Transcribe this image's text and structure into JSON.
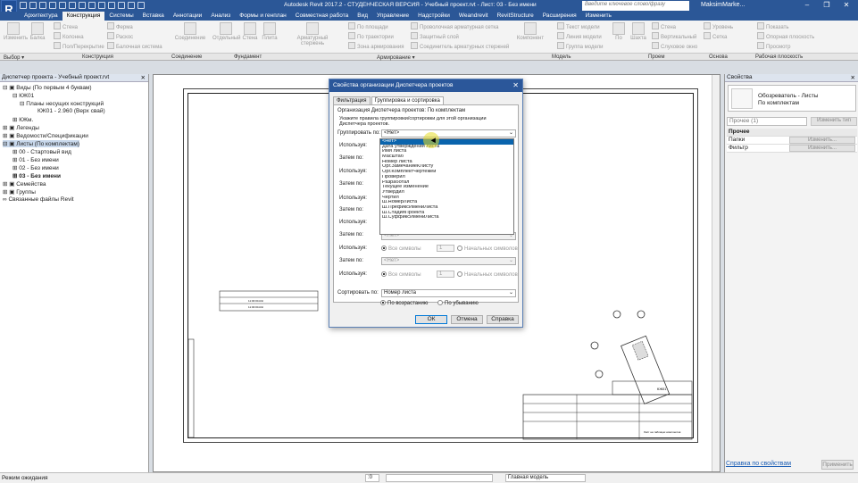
{
  "titlebar": {
    "logo": "R",
    "title": "Autodesk Revit 2017.2 - СТУДЕНЧЕСКАЯ ВЕРСИЯ -    Учебный проект.rvt - Лист: 03 - Без имени",
    "search_placeholder": "Введите ключевое слово/фразу",
    "user": "MaksimMarke...",
    "brand_color": "#2b5797"
  },
  "tabs": [
    "Архитектура",
    "Конструкция",
    "Системы",
    "Вставка",
    "Аннотации",
    "Анализ",
    "Формы и генплан",
    "Совместная работа",
    "Вид",
    "Управление",
    "Надстройки",
    "Weandrevit",
    "RevitStructure",
    "Расширения",
    "Изменить"
  ],
  "ribbon": {
    "tools": [
      "Изменить",
      "Балка",
      "Колонна",
      "Соединение",
      "Отдельный",
      "Стена",
      "Плита",
      "Арматурный стержень",
      "Компонент",
      "По",
      "Шахта",
      "Уровень"
    ],
    "small_tools": [
      "Стена",
      "Ферма",
      "Колонна",
      "Раскос",
      "Пол/Перекрытие",
      "Балочная система",
      "По площади",
      "По траектории",
      "Зона армирования",
      "Проволочная арматурная сетка",
      "Защитный слой",
      "Соединитель арматурных стержней",
      "Текст модели",
      "Линия модели",
      "Группа модели",
      "Стена",
      "Вертикальный",
      "Слуховое окно",
      "Сетка",
      "Показать",
      "Опорная плоскость",
      "Просмотр"
    ],
    "panels": [
      "Выбор ▾",
      "Конструкция",
      "Соединение",
      "Фундамент",
      "Армирование ▾",
      "Модель",
      "Проем",
      "Основа",
      "Рабочая плоскость"
    ]
  },
  "browser": {
    "title": "Диспетчер проекта - Учебный проект.rvt",
    "close": "✕",
    "nodes": [
      "Виды (По первым 4 буквам)",
      "КЖ01",
      "Планы несущих конструкций",
      "КЖ01 - 2.960 (Верх свай)",
      "КЖм.",
      "Легенды",
      "Ведомости/Спецификации",
      "Листы (По комплектам)",
      "00 - Стартовый вид",
      "01 - Без имени",
      "02 - Без имени",
      "03 - Без имени",
      "Семейства",
      "Группы",
      "Связанные файлы Revit"
    ]
  },
  "dialog": {
    "title": "Свойства организации Диспетчера проектов",
    "close": "✕",
    "tabs": [
      "Фильтрация",
      "Группировка и сортировка"
    ],
    "org_line": "Организация Диспетчера проектов: По комплектам",
    "hint_line1": "Укажите правила группировки/сортировки для этой организации",
    "hint_line2": "Диспетчера проектов.",
    "group_by_label": "Группировать по:",
    "group_by_value": "<Нет>",
    "use_label": "Используя:",
    "then_label": "Затем по:",
    "all_chars": "Все символы",
    "leading_chars": "Начальных символов",
    "spin_value": "1",
    "none_value": "<Нет>",
    "sort_label": "Сортировать по:",
    "sort_value": "Номер листа",
    "asc": "По возрастанию",
    "desc": "По убыванию",
    "ok": "ОК",
    "cancel": "Отмена",
    "help": "Справка"
  },
  "dropdown": {
    "items": [
      "<Нет>",
      "Дата утверждения листа",
      "Имя листа",
      "Масштаб",
      "Номер листа",
      "Орг.ЗамечаниеКЛисту",
      "Орг.КомплектЧертежей",
      "Проверил",
      "Разработал",
      "Текущее изменение",
      "Утвердил",
      "Чертил",
      "Ш.НомерЛиста",
      "Ш.ПрефиксИмениЛиста",
      "Ш.СтадияПроекта",
      "Ш.СуффиксИмениЛиста"
    ],
    "highlighted": 0
  },
  "properties": {
    "title": "Свойства",
    "close": "✕",
    "type_line1": "Обозреватель - Листы",
    "type_line2": "По комплектам",
    "instance_label": "Прочее (1)",
    "edit_type": "Изменить тип",
    "group_label": "Прочее",
    "rows": [
      {
        "name": "Папки",
        "button": "Изменить..."
      },
      {
        "name": "Фильтр",
        "button": "Изменить..."
      }
    ],
    "help_link": "Справка по свойствам",
    "apply": "Применить"
  },
  "statusbar": {
    "text": "Режим ожидания",
    "model": "Главная модель",
    "scale_value": ":0"
  },
  "sheet": {
    "stamp1": "11:00:00-КЖ",
    "stamp2": "11:00:00-КЖ",
    "code": "КЖ01",
    "caption": "Лист на таблицах комплектов"
  }
}
